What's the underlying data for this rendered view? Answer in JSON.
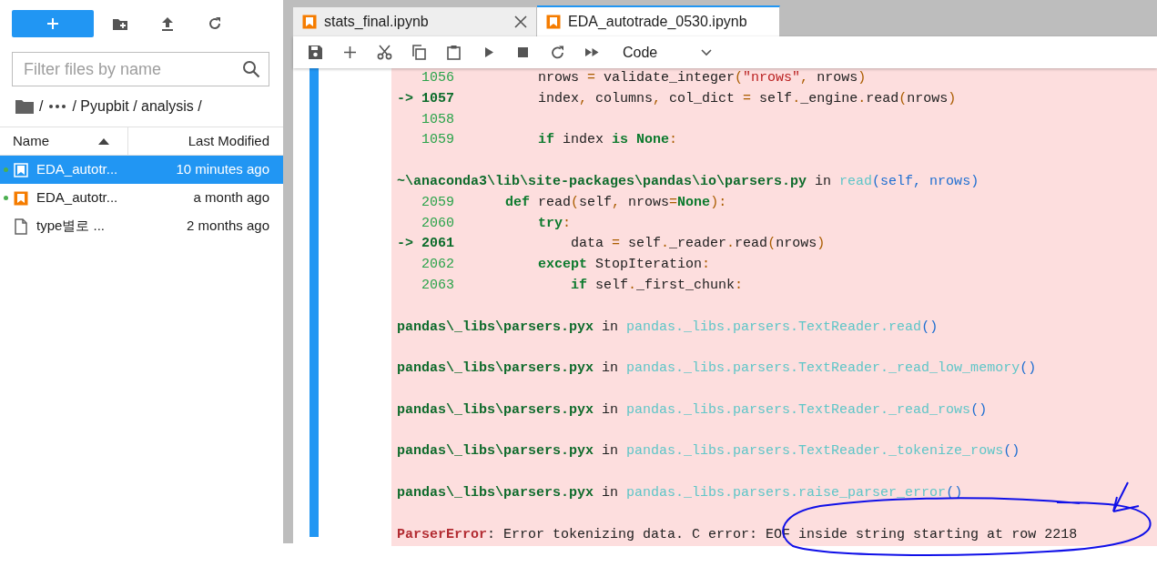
{
  "sidebar": {
    "filter": {
      "placeholder": "Filter files by name"
    },
    "breadcrumb": {
      "root": "/",
      "path": "/ Pyupbit / analysis /"
    },
    "columns": [
      {
        "label": "Name",
        "sorted": true
      },
      {
        "label": "Last Modified",
        "sorted": false
      }
    ],
    "files": [
      {
        "name": "EDA_autotr...",
        "modified": "10 minutes ago",
        "kind": "notebook",
        "running": true,
        "selected": true
      },
      {
        "name": "EDA_autotr...",
        "modified": "a month ago",
        "kind": "notebook",
        "running": true,
        "selected": false
      },
      {
        "name": "type별로 ...",
        "modified": "2 months ago",
        "kind": "file",
        "running": false,
        "selected": false
      }
    ]
  },
  "tabs": [
    {
      "label": "stats_final.ipynb",
      "selected": false
    },
    {
      "label": "EDA_autotrade_0530.ipynb",
      "selected": true
    }
  ],
  "toolbar": {
    "cell_type": "Code"
  },
  "traceback": [
    {
      "lines": [
        {
          "number": "1056",
          "current": false,
          "code": [
            {
              "kind": "name",
              "text": "        nrows "
            },
            {
              "kind": "op",
              "text": "="
            },
            {
              "kind": "name",
              "text": " validate_integer"
            },
            {
              "kind": "op",
              "text": "("
            },
            {
              "kind": "str",
              "text": "\"nrows\""
            },
            {
              "kind": "op",
              "text": ","
            },
            {
              "kind": "name",
              "text": " nrows"
            },
            {
              "kind": "op",
              "text": ")"
            }
          ]
        },
        {
          "marker": "->",
          "number": "1057",
          "current": true,
          "code": [
            {
              "kind": "name",
              "text": "        index"
            },
            {
              "kind": "op",
              "text": ","
            },
            {
              "kind": "name",
              "text": " columns"
            },
            {
              "kind": "op",
              "text": ","
            },
            {
              "kind": "name",
              "text": " col_dict "
            },
            {
              "kind": "op",
              "text": "="
            },
            {
              "kind": "name",
              "text": " self"
            },
            {
              "kind": "op",
              "text": "."
            },
            {
              "kind": "name",
              "text": "_engine"
            },
            {
              "kind": "op",
              "text": "."
            },
            {
              "kind": "name",
              "text": "read"
            },
            {
              "kind": "op",
              "text": "("
            },
            {
              "kind": "name",
              "text": "nrows"
            },
            {
              "kind": "op",
              "text": ")"
            }
          ]
        },
        {
          "number": "1058",
          "current": false
        },
        {
          "number": "1059",
          "current": false,
          "code": [
            {
              "kind": "kw",
              "text": "        if"
            },
            {
              "kind": "name",
              "text": " index "
            },
            {
              "kind": "kw",
              "text": "is"
            },
            {
              "kind": "kw",
              "text": " None"
            },
            {
              "kind": "op",
              "text": ":"
            }
          ]
        }
      ]
    },
    {
      "header": [
        {
          "kind": "path",
          "text": "~\\anaconda3\\lib\\site-packages\\pandas\\io\\parsers.py"
        },
        {
          "kind": "name",
          "text": " in "
        },
        {
          "kind": "func",
          "text": "read"
        },
        {
          "kind": "paren",
          "text": "(self, nrows)"
        }
      ],
      "lines": [
        {
          "number": "2059",
          "current": false,
          "code": [
            {
              "kind": "kw",
              "text": "    def"
            },
            {
              "kind": "name",
              "text": " read"
            },
            {
              "kind": "op",
              "text": "("
            },
            {
              "kind": "name",
              "text": "self"
            },
            {
              "kind": "op",
              "text": ","
            },
            {
              "kind": "name",
              "text": " nrows"
            },
            {
              "kind": "op",
              "text": "="
            },
            {
              "kind": "kw",
              "text": "None"
            },
            {
              "kind": "op",
              "text": "):"
            }
          ]
        },
        {
          "number": "2060",
          "current": false,
          "code": [
            {
              "kind": "kw",
              "text": "        try"
            },
            {
              "kind": "op",
              "text": ":"
            }
          ]
        },
        {
          "marker": "->",
          "number": "2061",
          "current": true,
          "code": [
            {
              "kind": "name",
              "text": "            data "
            },
            {
              "kind": "op",
              "text": "="
            },
            {
              "kind": "name",
              "text": " self"
            },
            {
              "kind": "op",
              "text": "."
            },
            {
              "kind": "name",
              "text": "_reader"
            },
            {
              "kind": "op",
              "text": "."
            },
            {
              "kind": "name",
              "text": "read"
            },
            {
              "kind": "op",
              "text": "("
            },
            {
              "kind": "name",
              "text": "nrows"
            },
            {
              "kind": "op",
              "text": ")"
            }
          ]
        },
        {
          "number": "2062",
          "current": false,
          "code": [
            {
              "kind": "kw",
              "text": "        except"
            },
            {
              "kind": "name",
              "text": " StopIteration"
            },
            {
              "kind": "op",
              "text": ":"
            }
          ]
        },
        {
          "number": "2063",
          "current": false,
          "code": [
            {
              "kind": "kw",
              "text": "            if"
            },
            {
              "kind": "name",
              "text": " self"
            },
            {
              "kind": "op",
              "text": "."
            },
            {
              "kind": "name",
              "text": "_first_chunk"
            },
            {
              "kind": "op",
              "text": ":"
            }
          ]
        }
      ]
    },
    {
      "header": [
        {
          "kind": "path",
          "text": "pandas\\_libs\\parsers.pyx"
        },
        {
          "kind": "name",
          "text": " in "
        },
        {
          "kind": "func",
          "text": "pandas._libs.parsers.TextReader.read"
        },
        {
          "kind": "paren",
          "text": "()"
        }
      ]
    },
    {
      "header": [
        {
          "kind": "path",
          "text": "pandas\\_libs\\parsers.pyx"
        },
        {
          "kind": "name",
          "text": " in "
        },
        {
          "kind": "func",
          "text": "pandas._libs.parsers.TextReader._read_low_memory"
        },
        {
          "kind": "paren",
          "text": "()"
        }
      ]
    },
    {
      "header": [
        {
          "kind": "path",
          "text": "pandas\\_libs\\parsers.pyx"
        },
        {
          "kind": "name",
          "text": " in "
        },
        {
          "kind": "func",
          "text": "pandas._libs.parsers.TextReader._read_rows"
        },
        {
          "kind": "paren",
          "text": "()"
        }
      ]
    },
    {
      "header": [
        {
          "kind": "path",
          "text": "pandas\\_libs\\parsers.pyx"
        },
        {
          "kind": "name",
          "text": " in "
        },
        {
          "kind": "func",
          "text": "pandas._libs.parsers.TextReader._tokenize_rows"
        },
        {
          "kind": "paren",
          "text": "()"
        }
      ]
    },
    {
      "header": [
        {
          "kind": "path",
          "text": "pandas\\_libs\\parsers.pyx"
        },
        {
          "kind": "name",
          "text": " in "
        },
        {
          "kind": "func",
          "text": "pandas._libs.parsers.raise_parser_error"
        },
        {
          "kind": "paren",
          "text": "()"
        }
      ]
    }
  ],
  "error": {
    "name": "ParserError",
    "message": ": Error tokenizing data. C error: EOF inside string starting at row 2218"
  }
}
